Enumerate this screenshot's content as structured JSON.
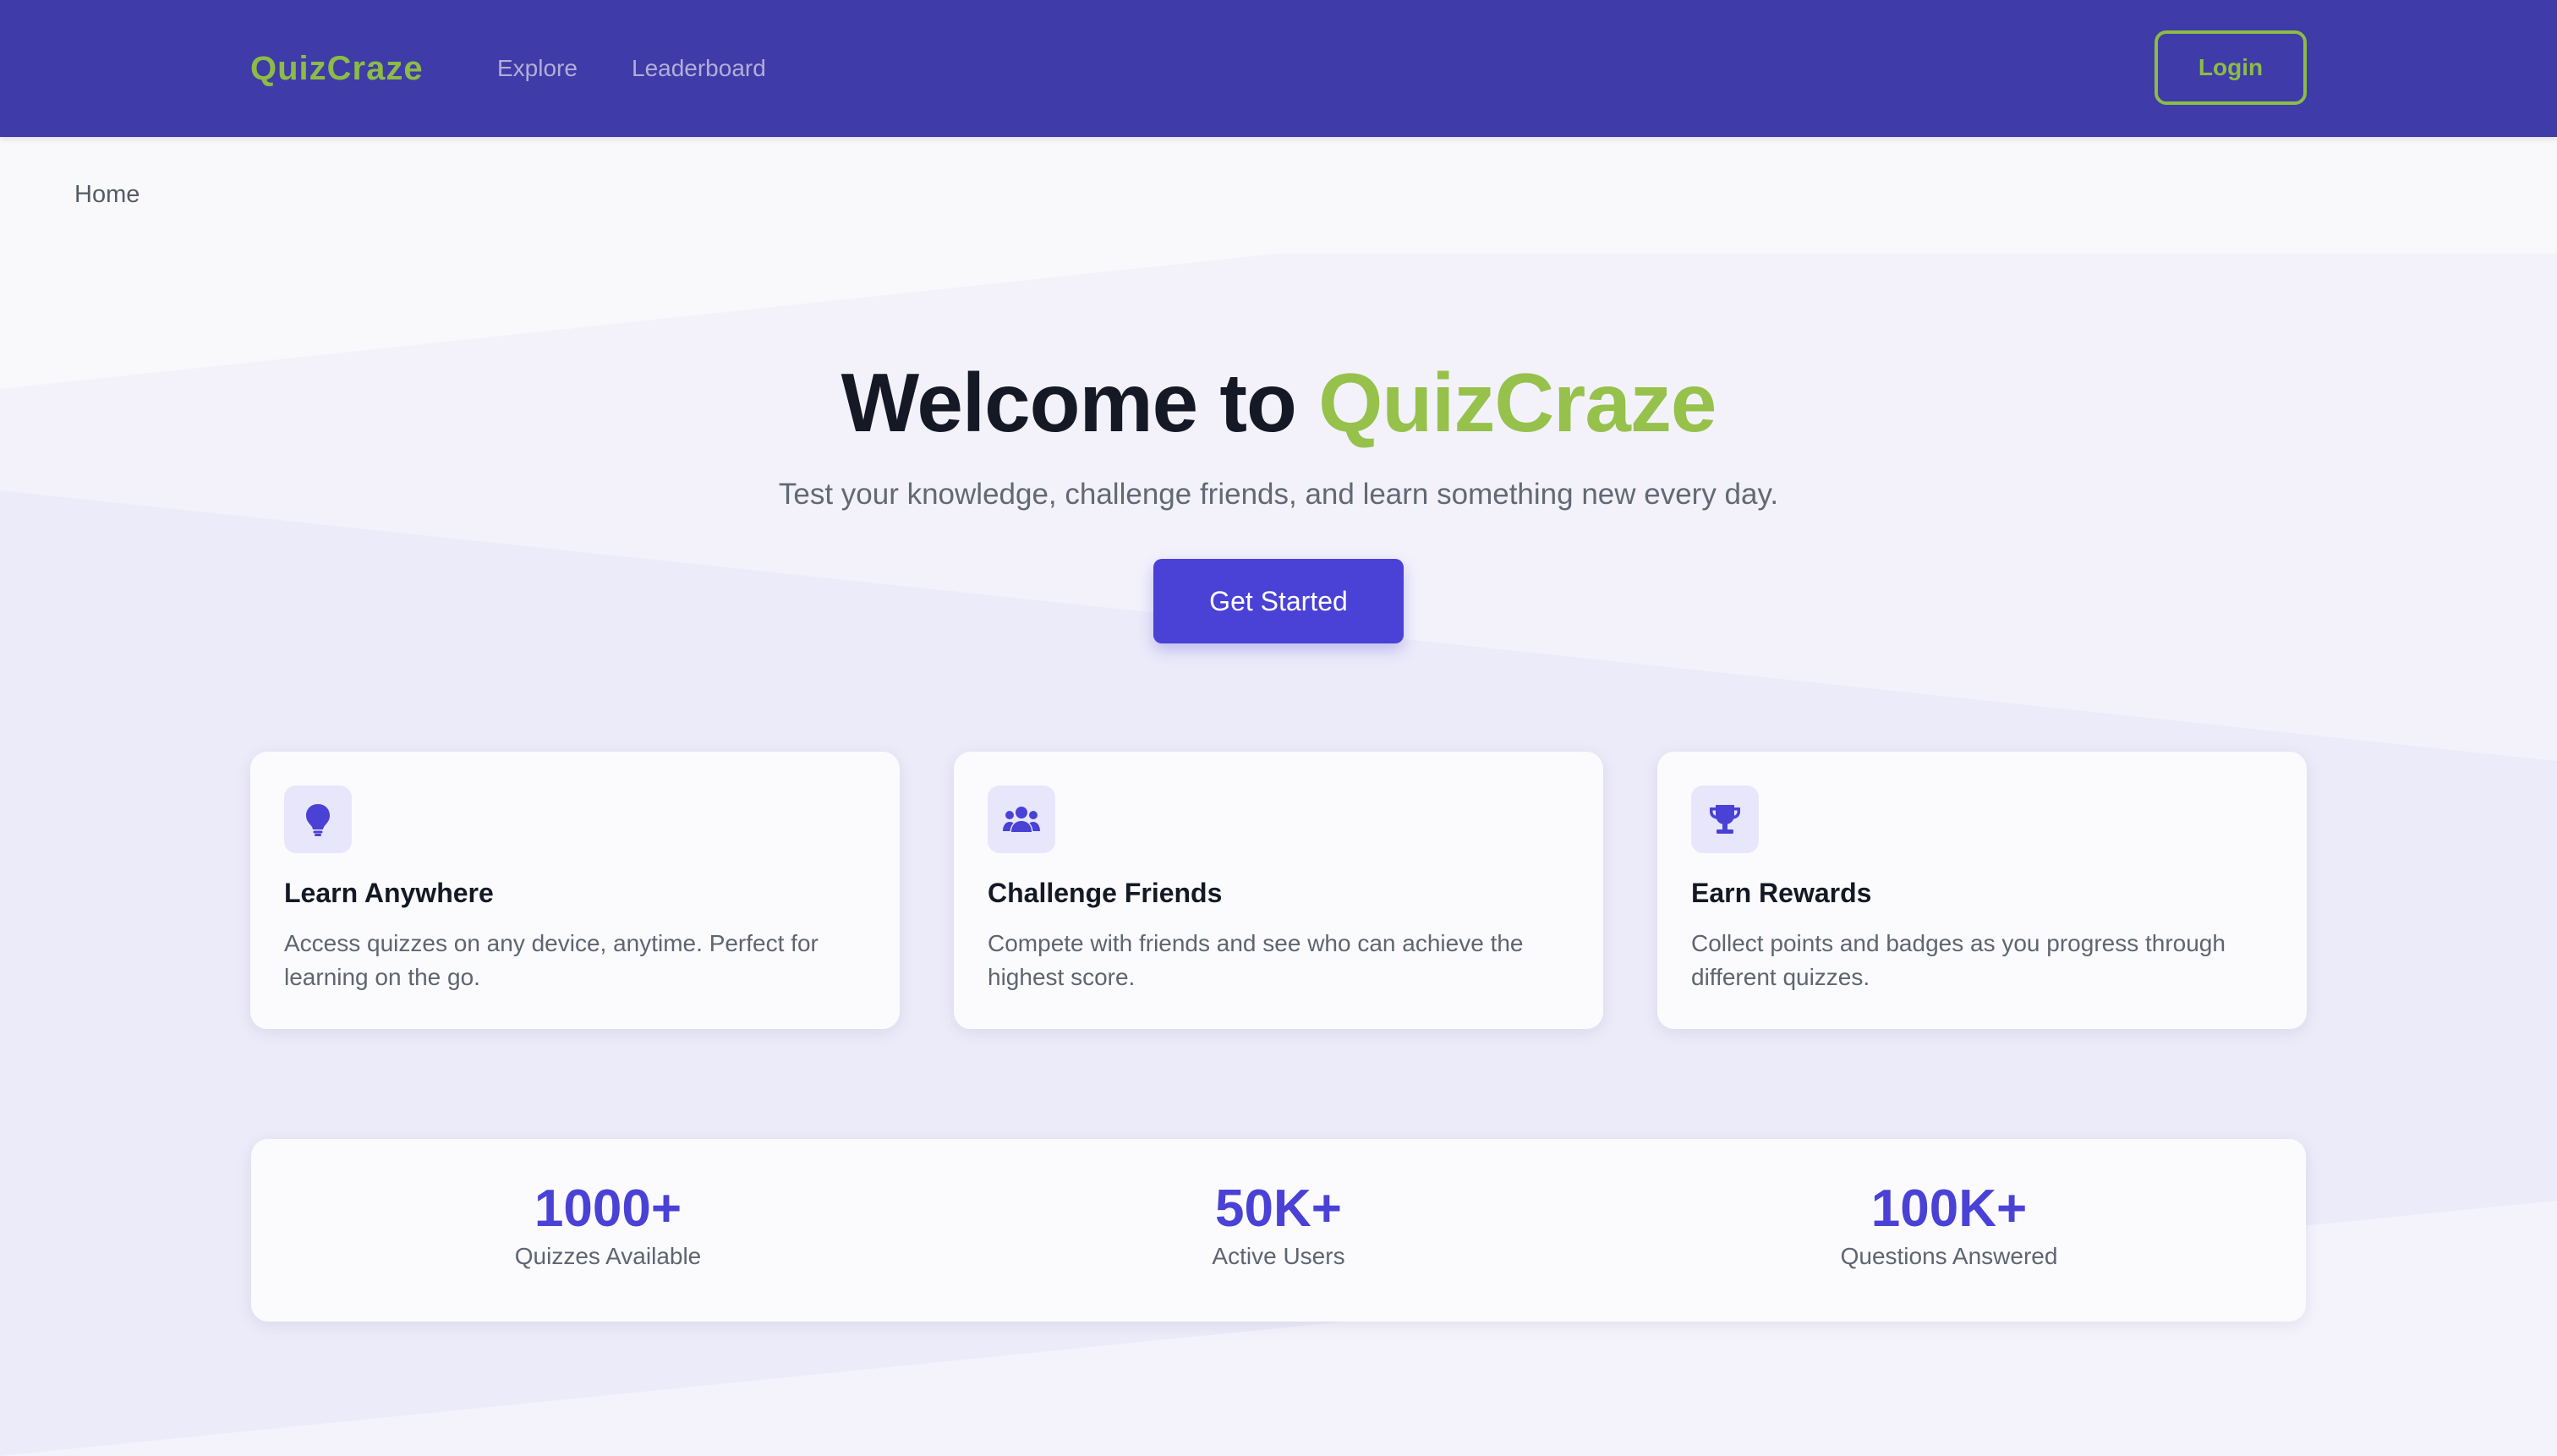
{
  "header": {
    "brand": "QuizCraze",
    "nav": [
      {
        "label": "Explore"
      },
      {
        "label": "Leaderboard"
      }
    ],
    "login_label": "Login"
  },
  "breadcrumb": {
    "current": "Home"
  },
  "hero": {
    "title_prefix": "Welcome to ",
    "title_accent": "QuizCraze",
    "subtitle": "Test your knowledge, challenge friends, and learn something new every day.",
    "cta_label": "Get Started"
  },
  "features": [
    {
      "icon": "lightbulb-icon",
      "title": "Learn Anywhere",
      "description": "Access quizzes on any device, anytime. Perfect for learning on the go."
    },
    {
      "icon": "users-icon",
      "title": "Challenge Friends",
      "description": "Compete with friends and see who can achieve the highest score."
    },
    {
      "icon": "trophy-icon",
      "title": "Earn Rewards",
      "description": "Collect points and badges as you progress through different quizzes."
    }
  ],
  "stats": [
    {
      "value": "1000+",
      "label": "Quizzes Available"
    },
    {
      "value": "50K+",
      "label": "Active Users"
    },
    {
      "value": "100K+",
      "label": "Questions Answered"
    }
  ],
  "colors": {
    "nav_background": "#3f3ba8",
    "brand_accent": "#8cbc45",
    "primary": "#4a41d6",
    "heading_text": "#141925",
    "body_text": "#5f6471"
  }
}
